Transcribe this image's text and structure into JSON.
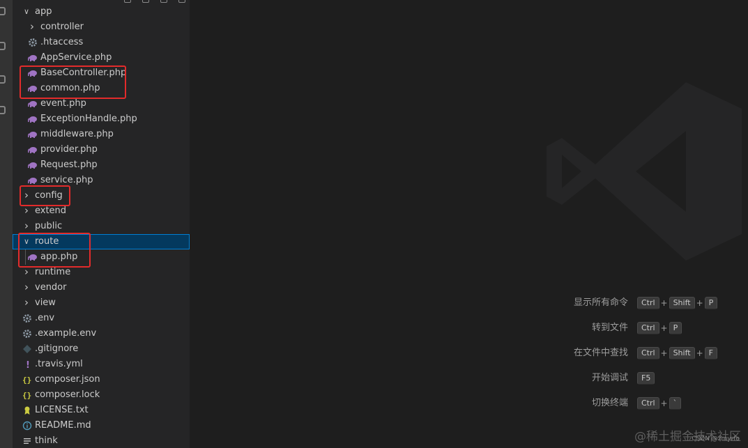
{
  "explorer": {
    "items": [
      {
        "label": "app",
        "kind": "folder",
        "state": "open",
        "depth": 0,
        "icon": "chevron-down-icon"
      },
      {
        "label": "controller",
        "kind": "folder",
        "state": "closed",
        "depth": 1,
        "icon": "chevron-right-icon"
      },
      {
        "label": ".htaccess",
        "kind": "file",
        "depth": 1,
        "icon": "gear-icon"
      },
      {
        "label": "AppService.php",
        "kind": "file",
        "depth": 1,
        "icon": "php-elephant-icon"
      },
      {
        "label": "BaseController.php",
        "kind": "file",
        "depth": 1,
        "icon": "php-elephant-icon"
      },
      {
        "label": "common.php",
        "kind": "file",
        "depth": 1,
        "icon": "php-elephant-icon"
      },
      {
        "label": "event.php",
        "kind": "file",
        "depth": 1,
        "icon": "php-elephant-icon"
      },
      {
        "label": "ExceptionHandle.php",
        "kind": "file",
        "depth": 1,
        "icon": "php-elephant-icon"
      },
      {
        "label": "middleware.php",
        "kind": "file",
        "depth": 1,
        "icon": "php-elephant-icon"
      },
      {
        "label": "provider.php",
        "kind": "file",
        "depth": 1,
        "icon": "php-elephant-icon"
      },
      {
        "label": "Request.php",
        "kind": "file",
        "depth": 1,
        "icon": "php-elephant-icon"
      },
      {
        "label": "service.php",
        "kind": "file",
        "depth": 1,
        "icon": "php-elephant-icon"
      },
      {
        "label": "config",
        "kind": "folder",
        "state": "closed",
        "depth": 0,
        "icon": "chevron-right-icon"
      },
      {
        "label": "extend",
        "kind": "folder",
        "state": "closed",
        "depth": 0,
        "icon": "chevron-right-icon"
      },
      {
        "label": "public",
        "kind": "folder",
        "state": "closed",
        "depth": 0,
        "icon": "chevron-right-icon"
      },
      {
        "label": "route",
        "kind": "folder",
        "state": "open",
        "depth": 0,
        "icon": "chevron-down-icon",
        "selected": true
      },
      {
        "label": "app.php",
        "kind": "file",
        "depth": 1,
        "icon": "php-elephant-icon"
      },
      {
        "label": "runtime",
        "kind": "folder",
        "state": "closed",
        "depth": 0,
        "icon": "chevron-right-icon"
      },
      {
        "label": "vendor",
        "kind": "folder",
        "state": "closed",
        "depth": 0,
        "icon": "chevron-right-icon"
      },
      {
        "label": "view",
        "kind": "folder",
        "state": "closed",
        "depth": 0,
        "icon": "chevron-right-icon"
      },
      {
        "label": ".env",
        "kind": "file",
        "depth": 0,
        "icon": "gear-icon"
      },
      {
        "label": ".example.env",
        "kind": "file",
        "depth": 0,
        "icon": "gear-icon"
      },
      {
        "label": ".gitignore",
        "kind": "file",
        "depth": 0,
        "icon": "git-diamond-icon"
      },
      {
        "label": ".travis.yml",
        "kind": "file",
        "depth": 0,
        "icon": "exclamation-icon"
      },
      {
        "label": "composer.json",
        "kind": "file",
        "depth": 0,
        "icon": "braces-icon"
      },
      {
        "label": "composer.lock",
        "kind": "file",
        "depth": 0,
        "icon": "braces-icon"
      },
      {
        "label": "LICENSE.txt",
        "kind": "file",
        "depth": 0,
        "icon": "license-ribbon-icon"
      },
      {
        "label": "README.md",
        "kind": "file",
        "depth": 0,
        "icon": "info-icon"
      },
      {
        "label": "think",
        "kind": "file",
        "depth": 0,
        "icon": "lines-icon"
      }
    ]
  },
  "shortcuts": [
    {
      "label": "显示所有命令",
      "keys": [
        "Ctrl",
        "Shift",
        "P"
      ]
    },
    {
      "label": "转到文件",
      "keys": [
        "Ctrl",
        "P"
      ]
    },
    {
      "label": "在文件中查找",
      "keys": [
        "Ctrl",
        "Shift",
        "F"
      ]
    },
    {
      "label": "开始调试",
      "keys": [
        "F5"
      ]
    },
    {
      "label": "切换终端",
      "keys": [
        "Ctrl",
        "`"
      ]
    }
  ],
  "watermark": {
    "main": "@稀土掘金技术社区",
    "sub": "CSDN @zmyrfo"
  },
  "colors": {
    "php": "#a074c4",
    "gear": "#8e9aa6",
    "braces": "#cbcb41",
    "yml": "#a074c4",
    "license": "#cbcb41",
    "info": "#519aba",
    "git": "#41535b",
    "highlight": "#e32b2b",
    "selected": "#04395e"
  }
}
